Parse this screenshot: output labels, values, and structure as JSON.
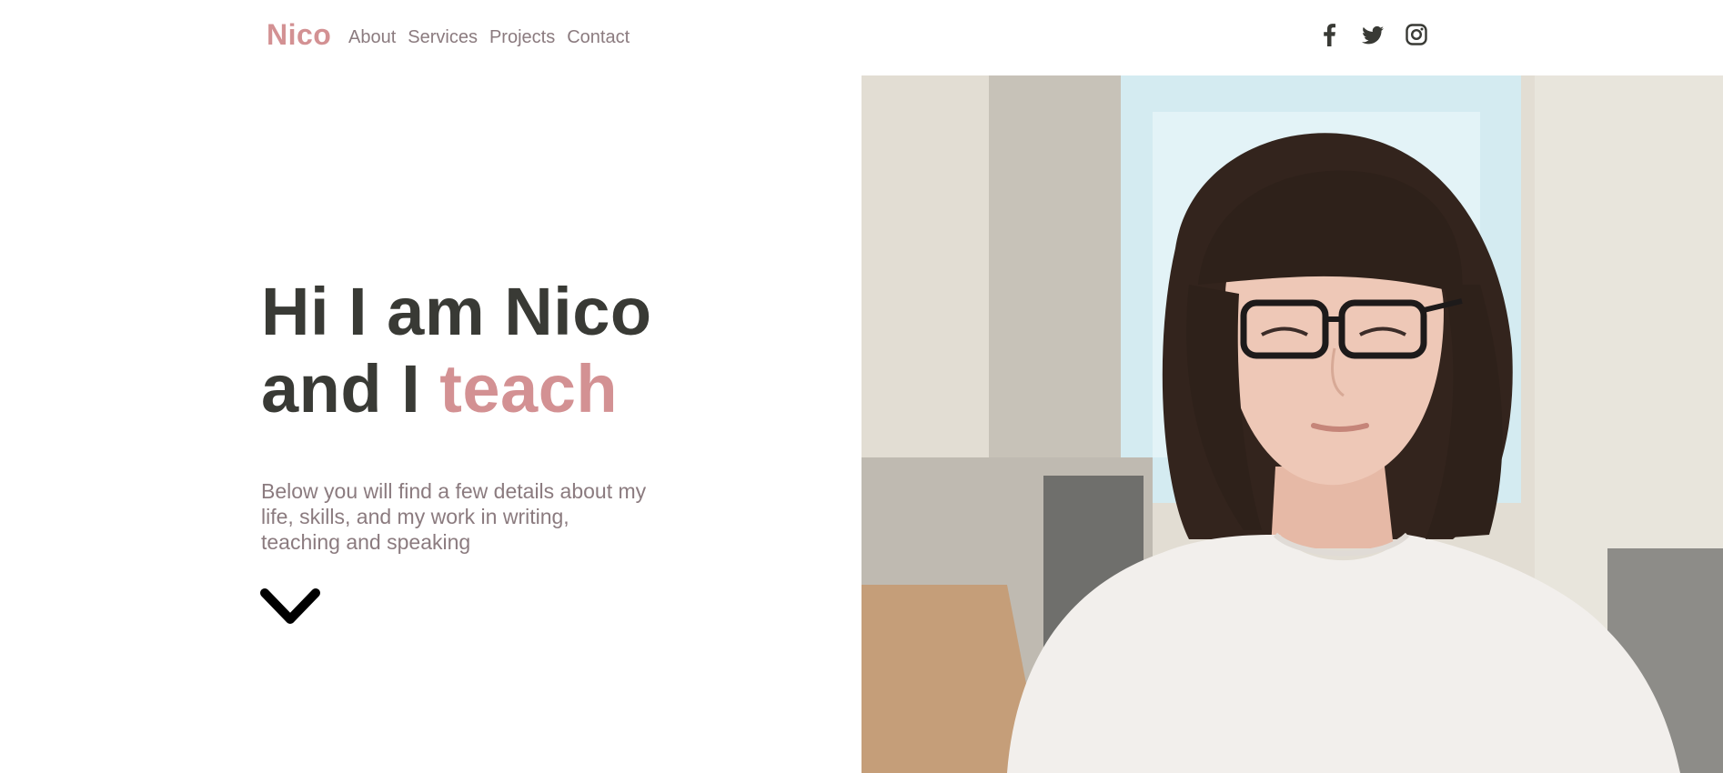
{
  "brand": {
    "logo": "Nico"
  },
  "nav": {
    "items": [
      {
        "label": "About"
      },
      {
        "label": "Services"
      },
      {
        "label": "Projects"
      },
      {
        "label": "Contact"
      }
    ]
  },
  "social": {
    "icons": [
      "facebook-icon",
      "twitter-icon",
      "instagram-icon"
    ]
  },
  "hero": {
    "line1": "Hi I am Nico",
    "line2_prefix": "and I ",
    "line2_accent": "teach",
    "intro": "Below you will find a few details about my life, skills, and my work in writing, teaching and speaking"
  },
  "colors": {
    "accent": "#d39193",
    "heading": "#393a35",
    "body_text": "#8b7b7f"
  }
}
